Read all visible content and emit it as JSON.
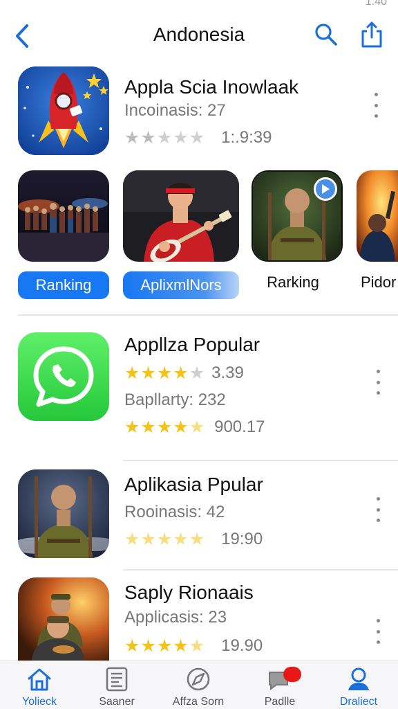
{
  "status": {
    "time": "1:40"
  },
  "nav": {
    "title": "Andonesia"
  },
  "featured_app": {
    "title": "Appla Scia Inowlaak",
    "subtitle": "Incoinasis: 27",
    "rating_text": "1:.9:39",
    "stars": [
      1,
      1,
      0.5,
      0,
      0
    ],
    "star_style": "gray"
  },
  "carousel": [
    {
      "label": "Ranking",
      "style": "blue"
    },
    {
      "label": "AplixmlNors",
      "style": "blue-fade"
    },
    {
      "label": "Rarking",
      "style": "plain"
    },
    {
      "label": "Pidor",
      "style": "plain"
    }
  ],
  "apps": [
    {
      "title": "Appllza Popular",
      "rating_value_1": "3.39",
      "subtitle": "Bapllarty: 232",
      "rating_value_2": "900.17",
      "stars_1": [
        1,
        1,
        1,
        1,
        0
      ],
      "stars_2": [
        1,
        1,
        1,
        1,
        0.5
      ]
    },
    {
      "title": "Aplikasia Ppular",
      "subtitle": "Rooinasis: 42",
      "rating_value": "19:90",
      "stars": [
        0.3,
        0.3,
        0.3,
        0.3,
        0.5
      ]
    },
    {
      "title": "Saply Rionaais",
      "subtitle": "Applicasis: 23",
      "rating_value": "19.90",
      "stars": [
        1,
        1,
        1,
        1,
        0.5
      ]
    }
  ],
  "tabs": [
    {
      "label": "Yolieck",
      "active": true
    },
    {
      "label": "Saaner",
      "active": false
    },
    {
      "label": "Affza Sorn",
      "active": false
    },
    {
      "label": "Padlle",
      "active": false
    },
    {
      "label": "Draliect",
      "active": true
    }
  ],
  "colors": {
    "accent": "#1a6fd8",
    "pill_blue": "#1877f2",
    "star": "#f4c318",
    "badge": "#e81818"
  }
}
